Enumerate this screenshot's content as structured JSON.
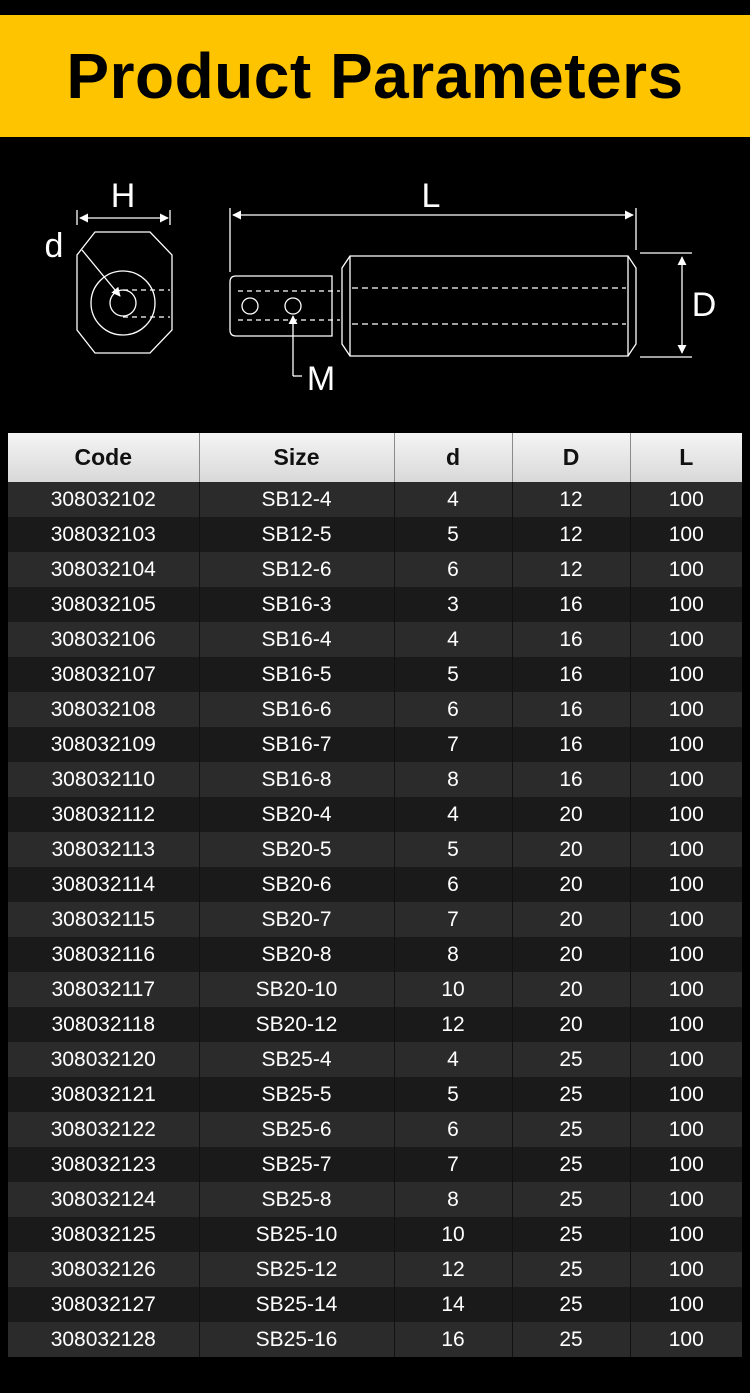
{
  "header": {
    "title": "Product Parameters",
    "background_color": "#ffc400"
  },
  "diagram": {
    "labels": {
      "H": "H",
      "d": "d",
      "L": "L",
      "D": "D",
      "M": "M"
    }
  },
  "table": {
    "columns": [
      "Code",
      "Size",
      "d",
      "D",
      "L"
    ],
    "rows": [
      [
        "308032102",
        "SB12-4",
        "4",
        "12",
        "100"
      ],
      [
        "308032103",
        "SB12-5",
        "5",
        "12",
        "100"
      ],
      [
        "308032104",
        "SB12-6",
        "6",
        "12",
        "100"
      ],
      [
        "308032105",
        "SB16-3",
        "3",
        "16",
        "100"
      ],
      [
        "308032106",
        "SB16-4",
        "4",
        "16",
        "100"
      ],
      [
        "308032107",
        "SB16-5",
        "5",
        "16",
        "100"
      ],
      [
        "308032108",
        "SB16-6",
        "6",
        "16",
        "100"
      ],
      [
        "308032109",
        "SB16-7",
        "7",
        "16",
        "100"
      ],
      [
        "308032110",
        "SB16-8",
        "8",
        "16",
        "100"
      ],
      [
        "308032112",
        "SB20-4",
        "4",
        "20",
        "100"
      ],
      [
        "308032113",
        "SB20-5",
        "5",
        "20",
        "100"
      ],
      [
        "308032114",
        "SB20-6",
        "6",
        "20",
        "100"
      ],
      [
        "308032115",
        "SB20-7",
        "7",
        "20",
        "100"
      ],
      [
        "308032116",
        "SB20-8",
        "8",
        "20",
        "100"
      ],
      [
        "308032117",
        "SB20-10",
        "10",
        "20",
        "100"
      ],
      [
        "308032118",
        "SB20-12",
        "12",
        "20",
        "100"
      ],
      [
        "308032120",
        "SB25-4",
        "4",
        "25",
        "100"
      ],
      [
        "308032121",
        "SB25-5",
        "5",
        "25",
        "100"
      ],
      [
        "308032122",
        "SB25-6",
        "6",
        "25",
        "100"
      ],
      [
        "308032123",
        "SB25-7",
        "7",
        "25",
        "100"
      ],
      [
        "308032124",
        "SB25-8",
        "8",
        "25",
        "100"
      ],
      [
        "308032125",
        "SB25-10",
        "10",
        "25",
        "100"
      ],
      [
        "308032126",
        "SB25-12",
        "12",
        "25",
        "100"
      ],
      [
        "308032127",
        "SB25-14",
        "14",
        "25",
        "100"
      ],
      [
        "308032128",
        "SB25-16",
        "16",
        "25",
        "100"
      ]
    ]
  }
}
